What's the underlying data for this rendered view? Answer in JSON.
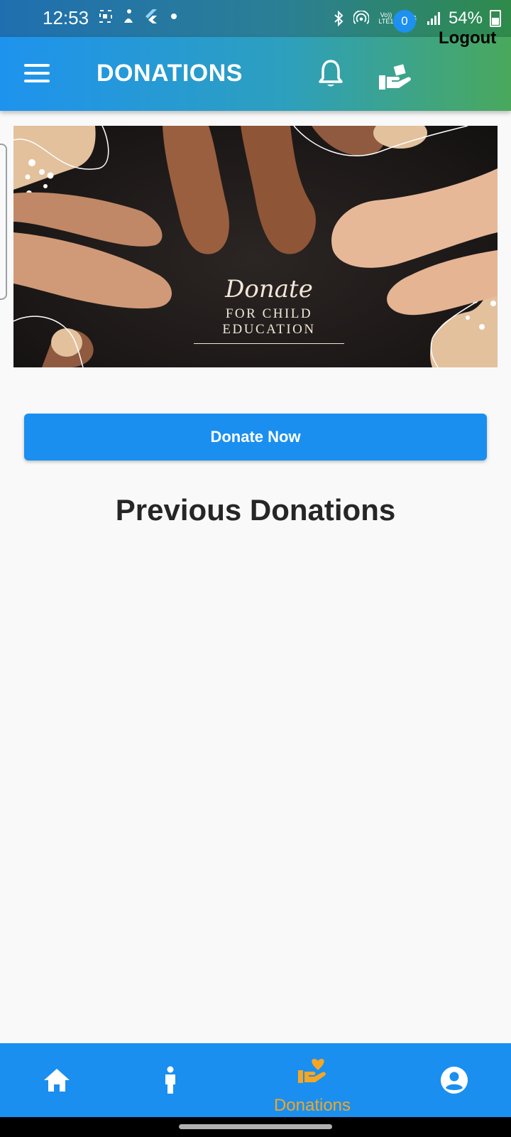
{
  "status_bar": {
    "time": "12:53",
    "battery_percent": "54%",
    "network": "4G",
    "volte": "Vo)) LTE1",
    "left_icons": [
      "screen-record-icon",
      "accessibility-icon",
      "flutter-icon",
      "dot-icon"
    ],
    "right_icons": [
      "bluetooth-icon",
      "hotspot-icon",
      "volte-icon",
      "4g-icon",
      "signal-icon",
      "battery-icon"
    ]
  },
  "app_bar": {
    "title": "DONATIONS",
    "cart_badge_count": "0",
    "logout_label": "Logout",
    "icons": [
      "menu-icon",
      "bell-icon",
      "donate-hand-icon"
    ]
  },
  "banner": {
    "title": "Donate",
    "subtitle": "FOR CHILD EDUCATION"
  },
  "main": {
    "donate_button_label": "Donate Now",
    "section_title": "Previous Donations"
  },
  "bottom_nav": {
    "active_index": 2,
    "items": [
      {
        "icon": "home-icon",
        "label": ""
      },
      {
        "icon": "person-icon",
        "label": ""
      },
      {
        "icon": "donation-heart-hand-icon",
        "label": "Donations"
      },
      {
        "icon": "account-circle-icon",
        "label": ""
      }
    ]
  },
  "colors": {
    "primary": "#1a8ff0",
    "accent_active": "#f5a623",
    "appbar_gradient_start": "#1e93ee",
    "appbar_gradient_end": "#4aa85c",
    "heading": "#262626"
  }
}
